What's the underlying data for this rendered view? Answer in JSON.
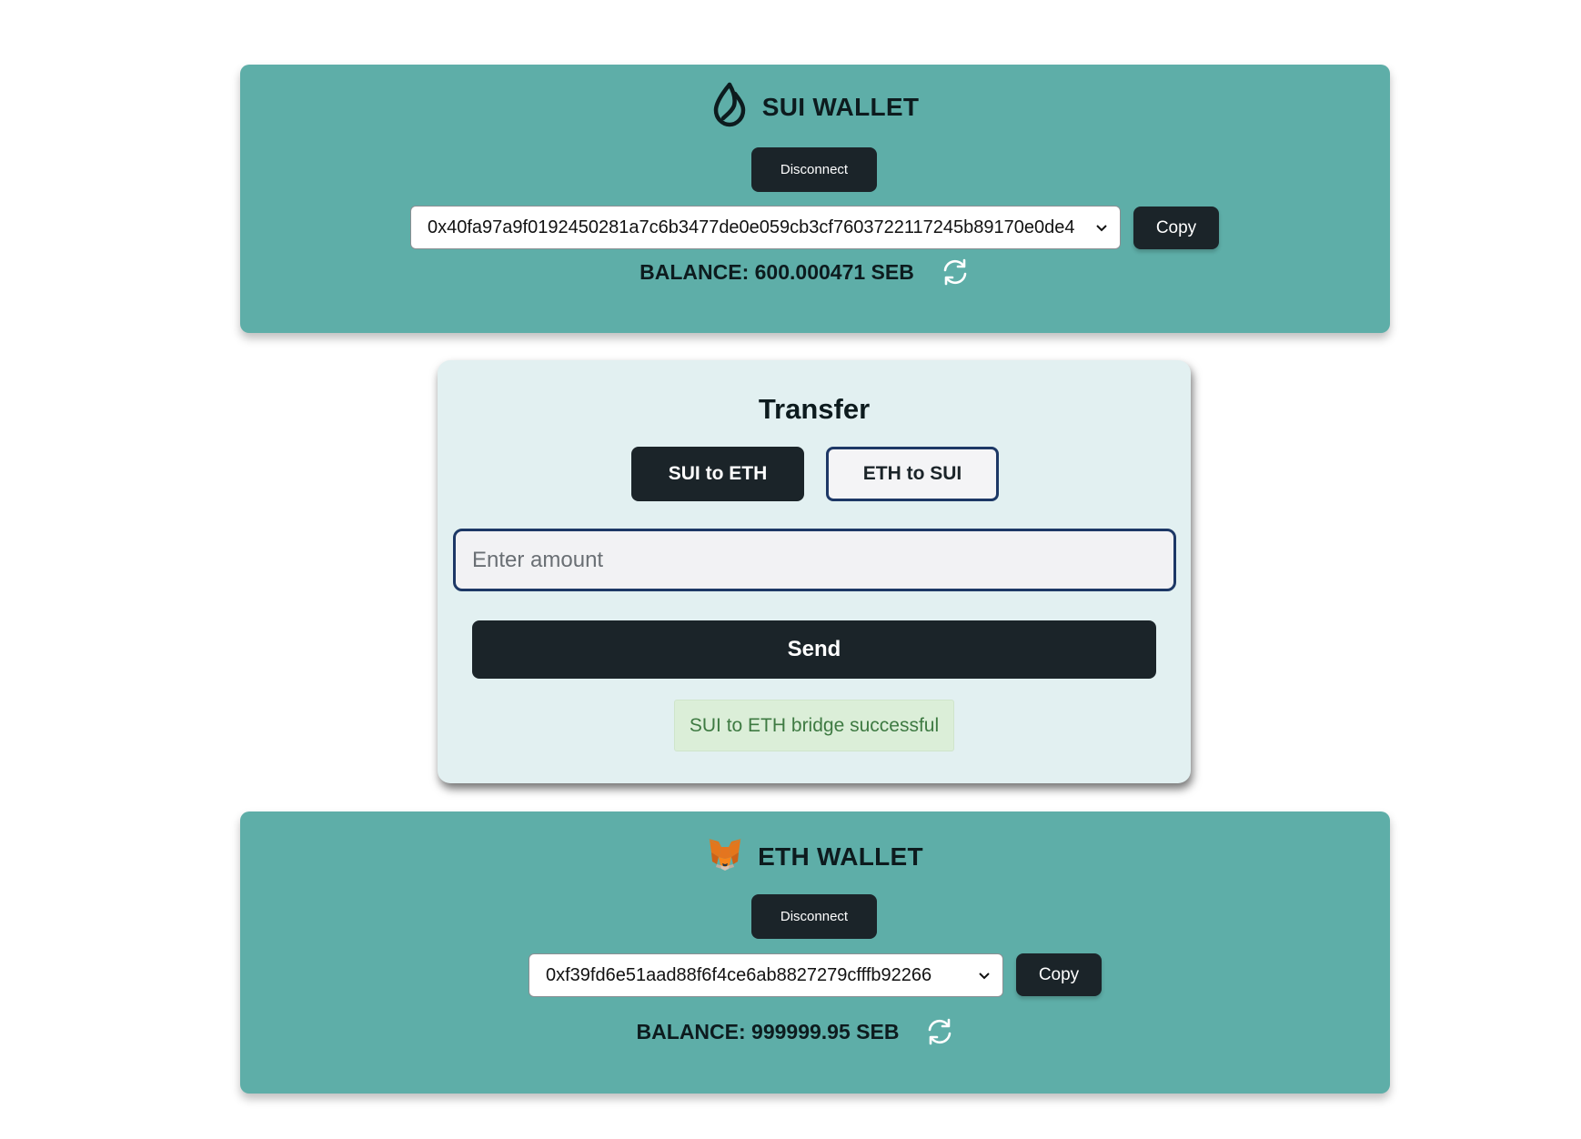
{
  "sui_wallet": {
    "icon": "sui-droplet-icon",
    "title": "SUI WALLET",
    "disconnect_label": "Disconnect",
    "address": "0x40fa97a9f0192450281a7c6b3477de0e059cb3cf7603722117245b89170e0de4",
    "copy_label": "Copy",
    "balance": "BALANCE: 600.000471 SEB",
    "refresh_icon": "refresh-icon"
  },
  "transfer": {
    "title": "Transfer",
    "direction_options": [
      "SUI to ETH",
      "ETH to SUI"
    ],
    "selected_direction": "SUI to ETH",
    "amount_placeholder": "Enter amount",
    "amount_value": "",
    "send_label": "Send",
    "status_message": "SUI to ETH bridge successful"
  },
  "eth_wallet": {
    "icon": "metamask-fox-icon",
    "title": "ETH WALLET",
    "disconnect_label": "Disconnect",
    "address": "0xf39fd6e51aad88f6f4ce6ab8827279cfffb92266",
    "copy_label": "Copy",
    "balance": "BALANCE: 999999.95 SEB",
    "refresh_icon": "refresh-icon"
  },
  "colors": {
    "wallet_bg": "#5eaea8",
    "transfer_bg": "#e2f0f1",
    "dark_button": "#1b2429",
    "outline_blue": "#1d3866",
    "success_bg": "#dbeed8",
    "success_text": "#3e7a42"
  }
}
